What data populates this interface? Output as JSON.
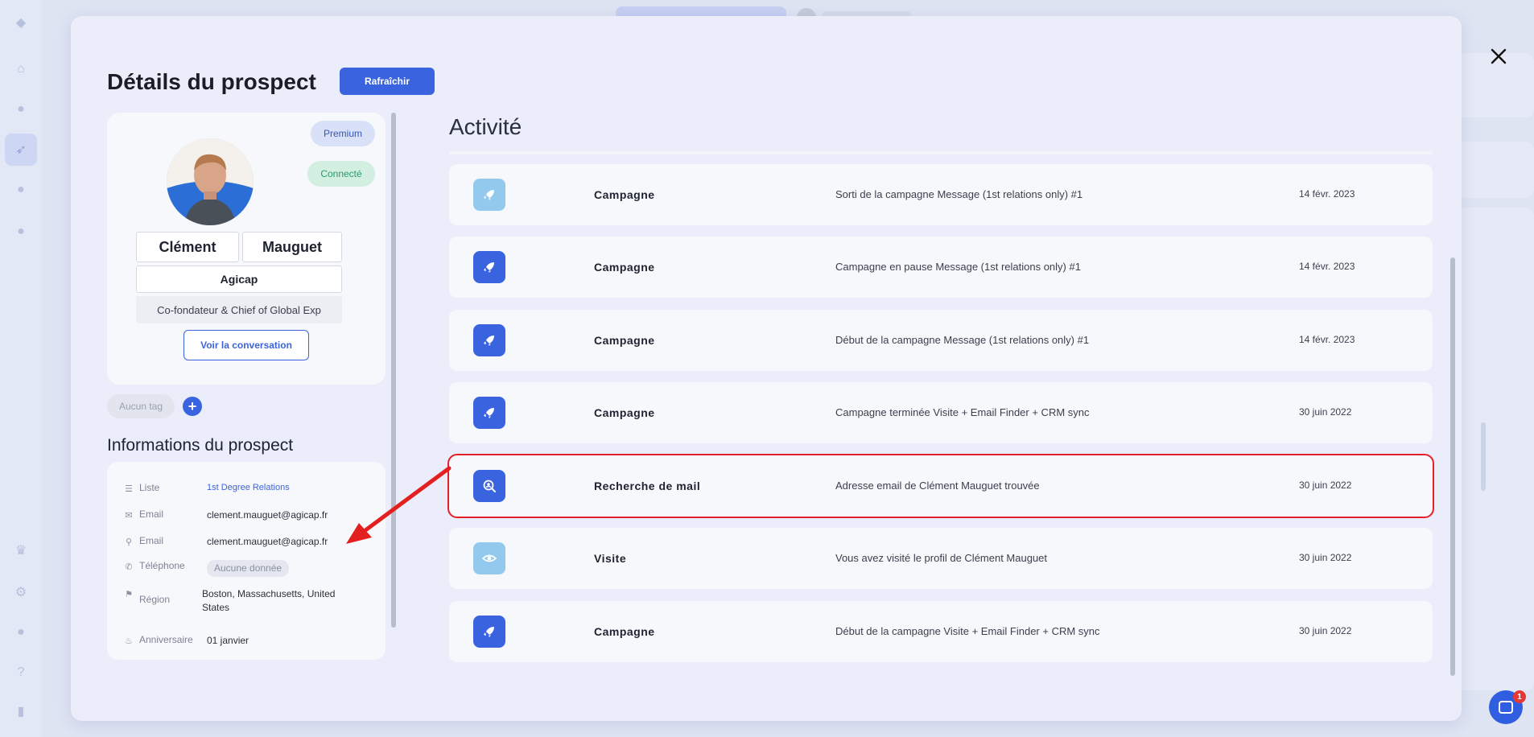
{
  "modal": {
    "title": "Détails du prospect",
    "refresh_label": "Rafraîchir",
    "close_icon": "close-icon"
  },
  "profile": {
    "first_name": "Clément",
    "last_name": "Mauguet",
    "company": "Agicap",
    "job_title": "Co-fondateur & Chief of Global Exp",
    "badge_premium": "Premium",
    "badge_connected": "Connecté",
    "conversation_button": "Voir la conversation",
    "tag_placeholder": "Aucun tag"
  },
  "info": {
    "title": "Informations du prospect",
    "rows": [
      {
        "label": "Liste",
        "value": "1st Degree Relations",
        "icon": "list-icon"
      },
      {
        "label": "Email",
        "value": "clement.mauguet@agicap.fr",
        "icon": "mail-icon"
      },
      {
        "label": "Email",
        "value": "clement.mauguet@agicap.fr",
        "icon": "search-user-icon"
      },
      {
        "label": "Téléphone",
        "value": "Aucune donnée",
        "icon": "phone-icon"
      },
      {
        "label": "Région",
        "value": "Boston, Massachusetts, United States",
        "icon": "pin-icon"
      },
      {
        "label": "Anniversaire",
        "value": "01 janvier",
        "icon": "cake-icon"
      }
    ]
  },
  "activity": {
    "title": "Activité",
    "rows": [
      {
        "type": "Campagne",
        "description": "Sorti de la campagne Message (1st relations only) #1",
        "date": "14 févr. 2023",
        "icon": "rocket-icon",
        "light": true
      },
      {
        "type": "Campagne",
        "description": "Campagne en pause Message (1st relations only) #1",
        "date": "14 févr. 2023",
        "icon": "rocket-icon",
        "light": false
      },
      {
        "type": "Campagne",
        "description": "Début de la campagne Message (1st relations only) #1",
        "date": "14 févr. 2023",
        "icon": "rocket-icon",
        "light": false
      },
      {
        "type": "Campagne",
        "description": "Campagne terminée Visite + Email Finder + CRM sync",
        "date": "30 juin 2022",
        "icon": "rocket-icon",
        "light": false
      },
      {
        "type": "Recherche de mail",
        "description": "Adresse email de Clément Mauguet trouvée",
        "date": "30 juin 2022",
        "icon": "search-user-icon",
        "light": false,
        "highlighted": true
      },
      {
        "type": "Visite",
        "description": "Vous avez visité le profil de Clément Mauguet",
        "date": "30 juin 2022",
        "icon": "eye-icon",
        "light": true
      },
      {
        "type": "Campagne",
        "description": "Début de la campagne Visite + Email Finder + CRM sync",
        "date": "30 juin 2022",
        "icon": "rocket-icon",
        "light": false
      }
    ]
  },
  "chat": {
    "badge_count": "1"
  },
  "colors": {
    "accent": "#3a63e0",
    "highlight": "#e5202a",
    "background": "#ebeefa"
  }
}
